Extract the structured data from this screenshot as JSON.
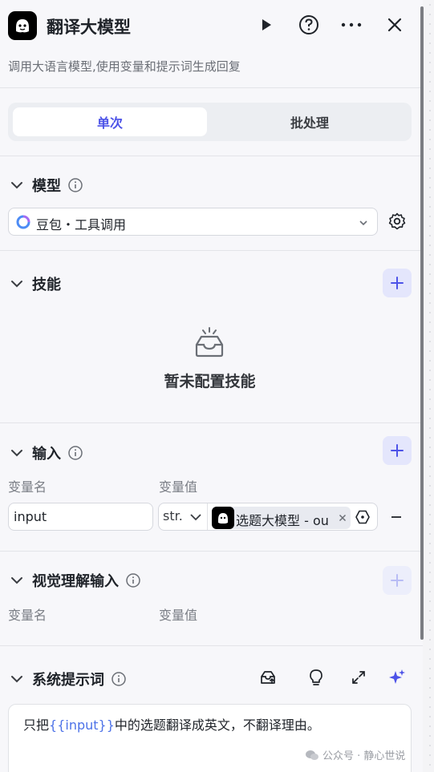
{
  "header": {
    "title": "翻译大模型",
    "subtitle": "调用大语言模型,使用变量和提示词生成回复"
  },
  "tabs": [
    "单次",
    "批处理"
  ],
  "model": {
    "title": "模型",
    "selected": "豆包・工具调用"
  },
  "skills": {
    "title": "技能",
    "empty": "暂未配置技能"
  },
  "input": {
    "title": "输入",
    "col_name": "变量名",
    "col_value": "变量值",
    "row": {
      "name": "input",
      "type": "str.",
      "ref": "选题大模型 - ou"
    }
  },
  "vision": {
    "title": "视觉理解输入",
    "col_name": "变量名",
    "col_value": "变量值"
  },
  "prompt": {
    "title": "系统提示词",
    "before": "只把",
    "var": "{{input}}",
    "after": "中的选题翻译成英文，不翻译理由。"
  },
  "watermark": "公众号 · 静心世说",
  "colors": {
    "accent": "#4d53e8",
    "panel": "#f7f7fa"
  }
}
